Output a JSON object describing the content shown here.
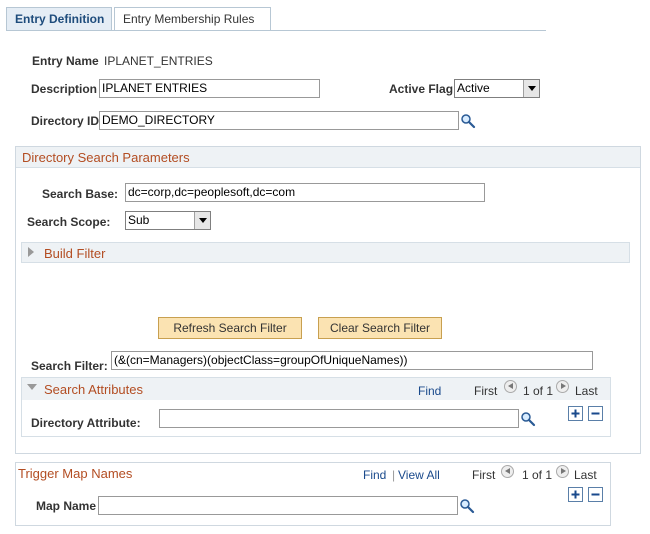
{
  "tabs": [
    {
      "label": "Entry Definition",
      "active": true
    },
    {
      "label": "Entry Membership Rules",
      "active": false
    }
  ],
  "entry": {
    "name_label": "Entry Name",
    "name_value": "IPLANET_ENTRIES",
    "description_label": "Description",
    "description_value": "IPLANET ENTRIES",
    "active_flag_label": "Active Flag",
    "active_flag_value": "Active",
    "directory_id_label": "Directory ID",
    "directory_id_value": "DEMO_DIRECTORY"
  },
  "search_params": {
    "header": "Directory Search Parameters",
    "search_base_label": "Search Base:",
    "search_base_value": "dc=corp,dc=peoplesoft,dc=com",
    "search_scope_label": "Search Scope:",
    "search_scope_value": "Sub",
    "build_filter_label": "Build Filter",
    "refresh_button": "Refresh Search Filter",
    "clear_button": "Clear Search Filter",
    "search_filter_label": "Search Filter:",
    "search_filter_value": "(&(cn=Managers)(objectClass=groupOfUniqueNames))"
  },
  "search_attributes": {
    "header": "Search Attributes",
    "find": "Find",
    "first": "First",
    "range": "1 of 1",
    "last": "Last",
    "directory_attribute_label": "Directory Attribute:",
    "directory_attribute_value": ""
  },
  "trigger_map": {
    "header": "Trigger Map Names",
    "find": "Find",
    "separator": "|",
    "view_all": "View All",
    "first": "First",
    "range": "1 of 1",
    "last": "Last",
    "map_name_label": "Map Name",
    "map_name_value": ""
  },
  "colors": {
    "accent_text": "#b34d22",
    "link": "#1a4a8c",
    "button_bg": "#fbe3b2",
    "header_bg": "#eef2f5"
  }
}
